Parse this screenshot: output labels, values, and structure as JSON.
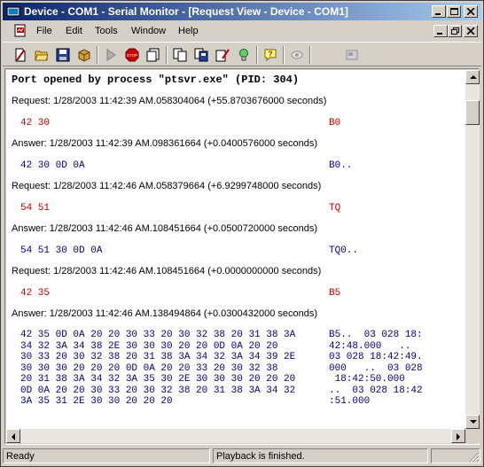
{
  "window": {
    "title": "Device - COM1 - Serial Monitor - [Request View - Device - COM1]"
  },
  "menu": {
    "items": [
      "File",
      "Edit",
      "Tools",
      "Window",
      "Help"
    ]
  },
  "toolbar": {
    "icons": [
      "new-icon",
      "open-icon",
      "save-icon",
      "package-icon",
      "play-icon",
      "stop-icon",
      "export-icon",
      "copy-icon",
      "paste-icon",
      "clear-icon",
      "capture-icon",
      "help-icon",
      "eye-icon",
      "settings-icon"
    ]
  },
  "log": {
    "header": "Port opened by process \"ptsvr.exe\" (PID: 304)",
    "entries": [
      {
        "label": "Request: 1/28/2003 11:42:39 AM.058304064 (+55.8703676000 seconds)",
        "kind": "req",
        "hex": "42 30",
        "ascii": "B0"
      },
      {
        "label": "Answer: 1/28/2003 11:42:39 AM.098361664 (+0.0400576000 seconds)",
        "kind": "ans",
        "hex": "42 30 0D 0A",
        "ascii": "B0.."
      },
      {
        "label": "Request: 1/28/2003 11:42:46 AM.058379664 (+6.9299748000 seconds)",
        "kind": "req",
        "hex": "54 51",
        "ascii": "TQ"
      },
      {
        "label": "Answer: 1/28/2003 11:42:46 AM.108451664 (+0.0500720000 seconds)",
        "kind": "ans",
        "hex": "54 51 30 0D 0A",
        "ascii": "TQ0.."
      },
      {
        "label": "Request: 1/28/2003 11:42:46 AM.108451664 (+0.0000000000 seconds)",
        "kind": "req",
        "hex": "42 35",
        "ascii": "B5"
      },
      {
        "label": "Answer: 1/28/2003 11:42:46 AM.138494864 (+0.0300432000 seconds)",
        "kind": "ans",
        "hex": "42 35 0D 0A 20 20 30 33 20 30 32 38 20 31 38 3A\n34 32 3A 34 38 2E 30 30 30 20 20 0D 0A 20 20\n30 33 20 30 32 38 20 31 38 3A 34 32 3A 34 39 2E\n30 30 30 20 20 20 0D 0A 20 20 33 20 30 32 38\n20 31 38 3A 34 32 3A 35 30 2E 30 30 30 20 20 20\n0D 0A 20 20 30 33 20 30 32 38 20 31 38 3A 34 32\n3A 35 31 2E 30 30 20 20 20",
        "ascii": "B5..  03 028 18:\n42:48.000   ..\n03 028 18:42:49.\n000   ..  03 028\n 18:42:50.000\n..  03 028 18:42\n:51.000"
      }
    ]
  },
  "status": {
    "left": "Ready",
    "middle": "Playback is finished.",
    "right": ""
  }
}
